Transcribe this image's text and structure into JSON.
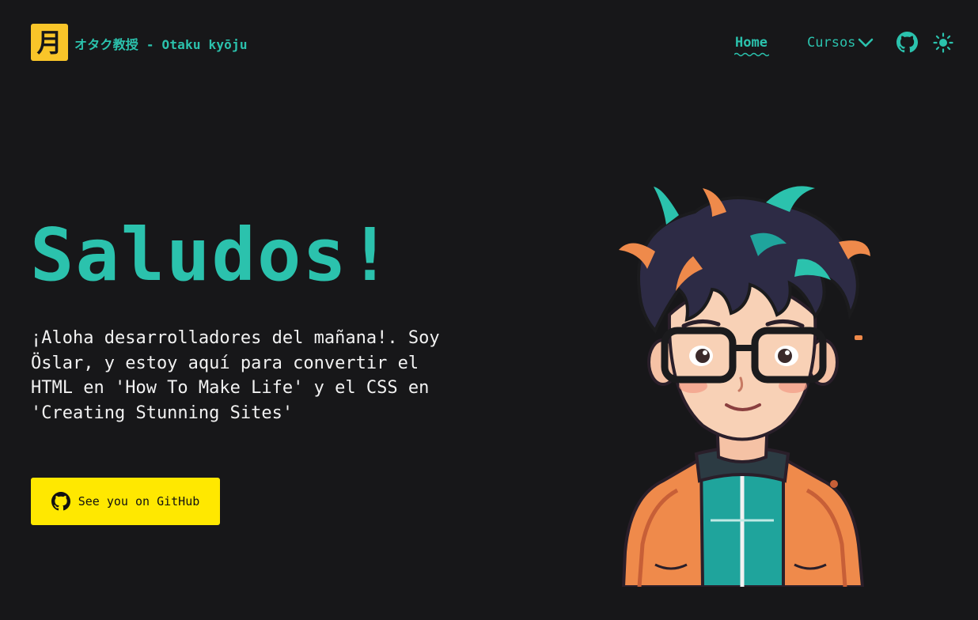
{
  "header": {
    "logo_glyph": "月",
    "site_title": "オタク教授 - Otaku kyōju"
  },
  "nav": {
    "home_label": "Home",
    "cursos_label": "Cursos",
    "github_icon": "github-icon",
    "theme_icon": "sun-icon"
  },
  "hero": {
    "title": "Saludos!",
    "text": "¡Aloha desarrolladores del mañana!. Soy Öslar, y estoy aquí para convertir el HTML en 'How To Make Life' y el CSS en 'Creating Stunning Sites'",
    "cta_label": "See you on GitHub",
    "cta_icon": "github-icon"
  },
  "colors": {
    "background": "#171719",
    "accent": "#2bc2ad",
    "logo_bg": "#f9c529",
    "cta_bg": "#ffe800",
    "text": "#f2f2f2"
  }
}
